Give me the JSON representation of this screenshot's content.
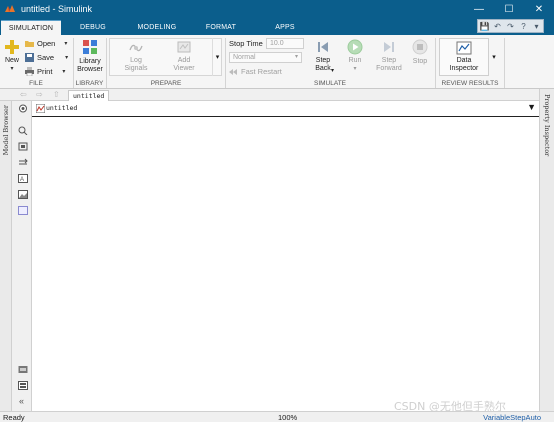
{
  "window": {
    "title": "untitled - Simulink"
  },
  "tabs": [
    {
      "label": "SIMULATION",
      "active": true
    },
    {
      "label": "DEBUG"
    },
    {
      "label": "MODELING"
    },
    {
      "label": "FORMAT"
    },
    {
      "label": "APPS"
    }
  ],
  "ribbon": {
    "file": {
      "group_label": "FILE",
      "new_label": "New",
      "open_label": "Open",
      "save_label": "Save",
      "print_label": "Print"
    },
    "library": {
      "group_label": "LIBRARY",
      "library_browser_label_1": "Library",
      "library_browser_label_2": "Browser"
    },
    "prepare": {
      "group_label": "PREPARE",
      "log_signals_1": "Log",
      "log_signals_2": "Signals",
      "add_viewer_1": "Add",
      "add_viewer_2": "Viewer"
    },
    "simulate": {
      "group_label": "SIMULATE",
      "stop_time_label": "Stop Time",
      "stop_time_value": "10.0",
      "mode_value": "Normal",
      "fast_restart_label": "Fast Restart",
      "step_back_1": "Step",
      "step_back_2": "Back",
      "run_label": "Run",
      "step_forward_1": "Step",
      "step_forward_2": "Forward",
      "stop_label": "Stop"
    },
    "review": {
      "group_label": "REVIEW RESULTS",
      "data_inspector_1": "Data",
      "data_inspector_2": "Inspector"
    }
  },
  "navbar": {
    "breadcrumb": "untitled"
  },
  "canvas": {
    "model_path": "untitled"
  },
  "side_panels": {
    "left_label": "Model Browser",
    "right_label": "Property Inspector"
  },
  "status": {
    "left": "Ready",
    "zoom": "100%",
    "solver": "VariableStepAuto"
  },
  "watermark": "CSDN @无他但手熟尔",
  "colors": {
    "titlebar": "#0b5e8c",
    "run_green": "#3aa53a",
    "status_blue": "#1f5fa8"
  }
}
